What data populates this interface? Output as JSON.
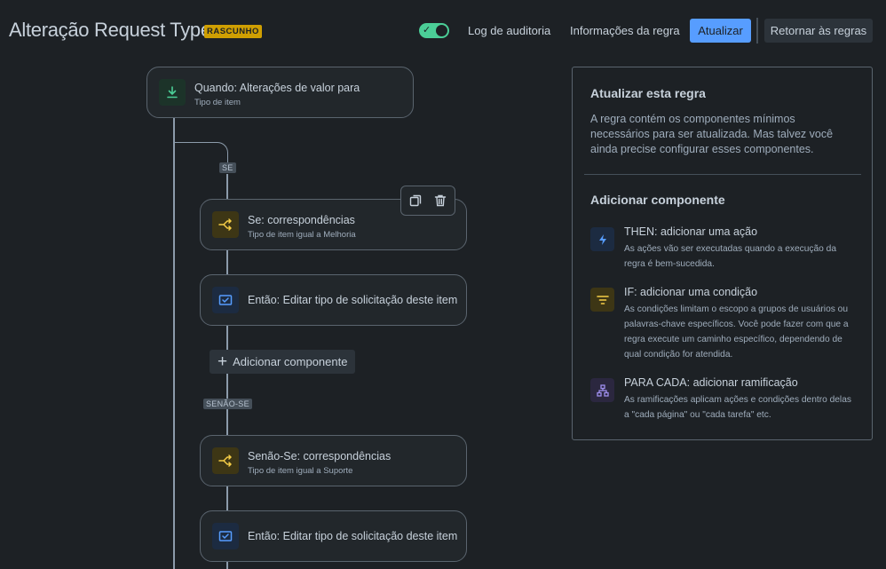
{
  "header": {
    "title": "Alteração Request Type",
    "badge": "RASCUNHO",
    "audit_log": "Log de auditoria",
    "rule_info": "Informações da regra",
    "update": "Atualizar",
    "back": "Retornar às regras",
    "rule_enabled": true
  },
  "flow": {
    "trigger": {
      "title": "Quando: Alterações de valor para",
      "subtitle": "Tipo de item",
      "icon": "download-icon"
    },
    "if_tag": "SE",
    "if_card": {
      "title": "Se: correspondências",
      "subtitle": "Tipo de item igual a Melhoria",
      "icon": "branch-icon"
    },
    "then_card_1": {
      "title": "Então: Editar tipo de solicitação deste item",
      "icon": "edit-screen-icon"
    },
    "add_component": "Adicionar componente",
    "elseif_tag": "SENÃO-SE",
    "elseif_card": {
      "title": "Senão-Se: correspondências",
      "subtitle": "Tipo de item igual a Suporte",
      "icon": "branch-icon"
    },
    "then_card_2": {
      "title": "Então: Editar tipo de solicitação deste item",
      "icon": "edit-screen-icon"
    }
  },
  "panel": {
    "update_title": "Atualizar esta regra",
    "update_desc": "A regra contém os componentes mínimos necessários para ser atualizada. Mas talvez você ainda precise configurar esses componentes.",
    "add_title": "Adicionar componente",
    "options": [
      {
        "title": "THEN: adicionar uma ação",
        "desc": "As ações vão ser executadas quando a execução da regra é bem-sucedida.",
        "icon": "lightning-icon",
        "color": "#579dff"
      },
      {
        "title": "IF: adicionar uma condição",
        "desc": "As condições limitam o escopo a grupos de usuários ou palavras-chave específicos. Você pode fazer com que a regra execute um caminho específico, dependendo de qual condição for atendida.",
        "icon": "filter-icon",
        "color": "#f5cd47"
      },
      {
        "title": "PARA CADA: adicionar ramificação",
        "desc": "As ramificações aplicam ações e condições dentro delas a \"cada página\" ou \"cada tarefa\" etc.",
        "icon": "hierarchy-icon",
        "color": "#9f8fef"
      }
    ]
  },
  "colors": {
    "background": "#1d2125",
    "accent_blue": "#579dff",
    "draft_badge": "#cf9f02",
    "toggle_on": "#4bce97"
  }
}
